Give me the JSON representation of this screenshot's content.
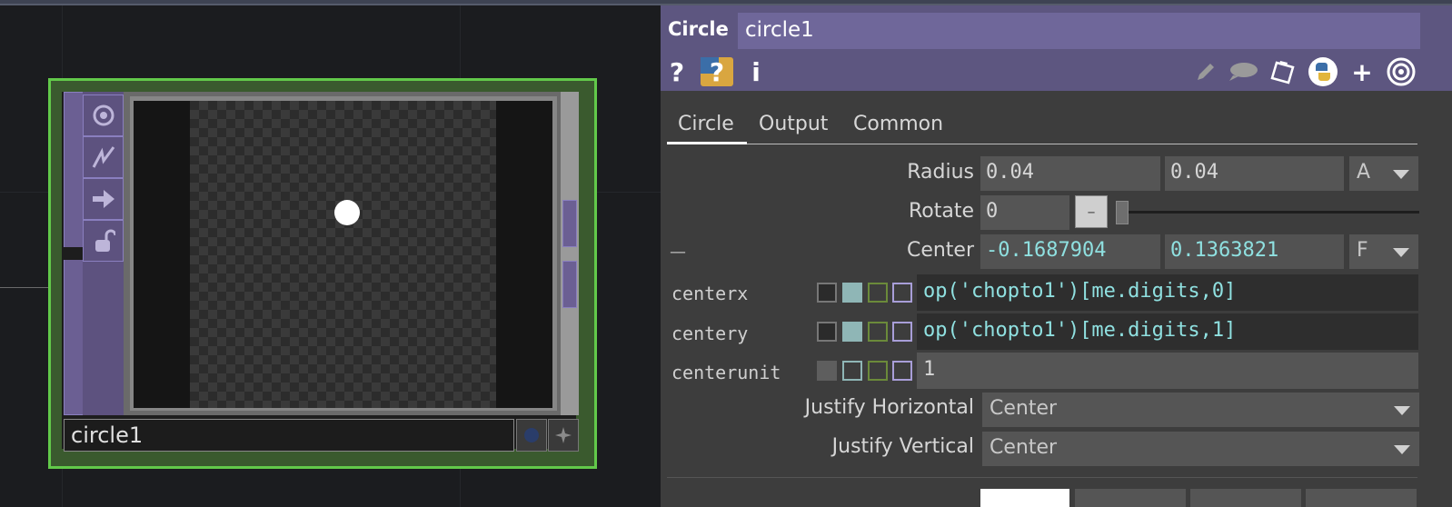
{
  "node": {
    "name": "circle1",
    "icons": [
      "viewer-toggle-icon",
      "bypass-icon",
      "export-arrow-icon",
      "lock-icon"
    ]
  },
  "panel": {
    "op_type": "Circle",
    "op_name": "circle1",
    "tabs": [
      "Circle",
      "Output",
      "Common"
    ],
    "active_tab": "Circle",
    "params": {
      "radius": {
        "label": "Radius",
        "values": [
          "0.04",
          "0.04"
        ],
        "menu": "A"
      },
      "rotate": {
        "label": "Rotate",
        "value": "0",
        "knob": "–"
      },
      "center": {
        "label": "Center",
        "values": [
          "-0.1687904",
          "0.1363821"
        ],
        "menu": "F",
        "dash": "—"
      },
      "centerx": {
        "label": "centerx",
        "expr": "op('chopto1')[me.digits,0]"
      },
      "centery": {
        "label": "centery",
        "expr": "op('chopto1')[me.digits,1]"
      },
      "centerunit": {
        "label": "centerunit",
        "value": "1"
      },
      "justify_h": {
        "label": "Justify Horizontal",
        "value": "Center"
      },
      "justify_v": {
        "label": "Justify Vertical",
        "value": "Center"
      }
    }
  },
  "colors": {
    "node_border": "#62c94a",
    "header_bg": "#5d5680",
    "expression_text": "#8fe0e0"
  }
}
